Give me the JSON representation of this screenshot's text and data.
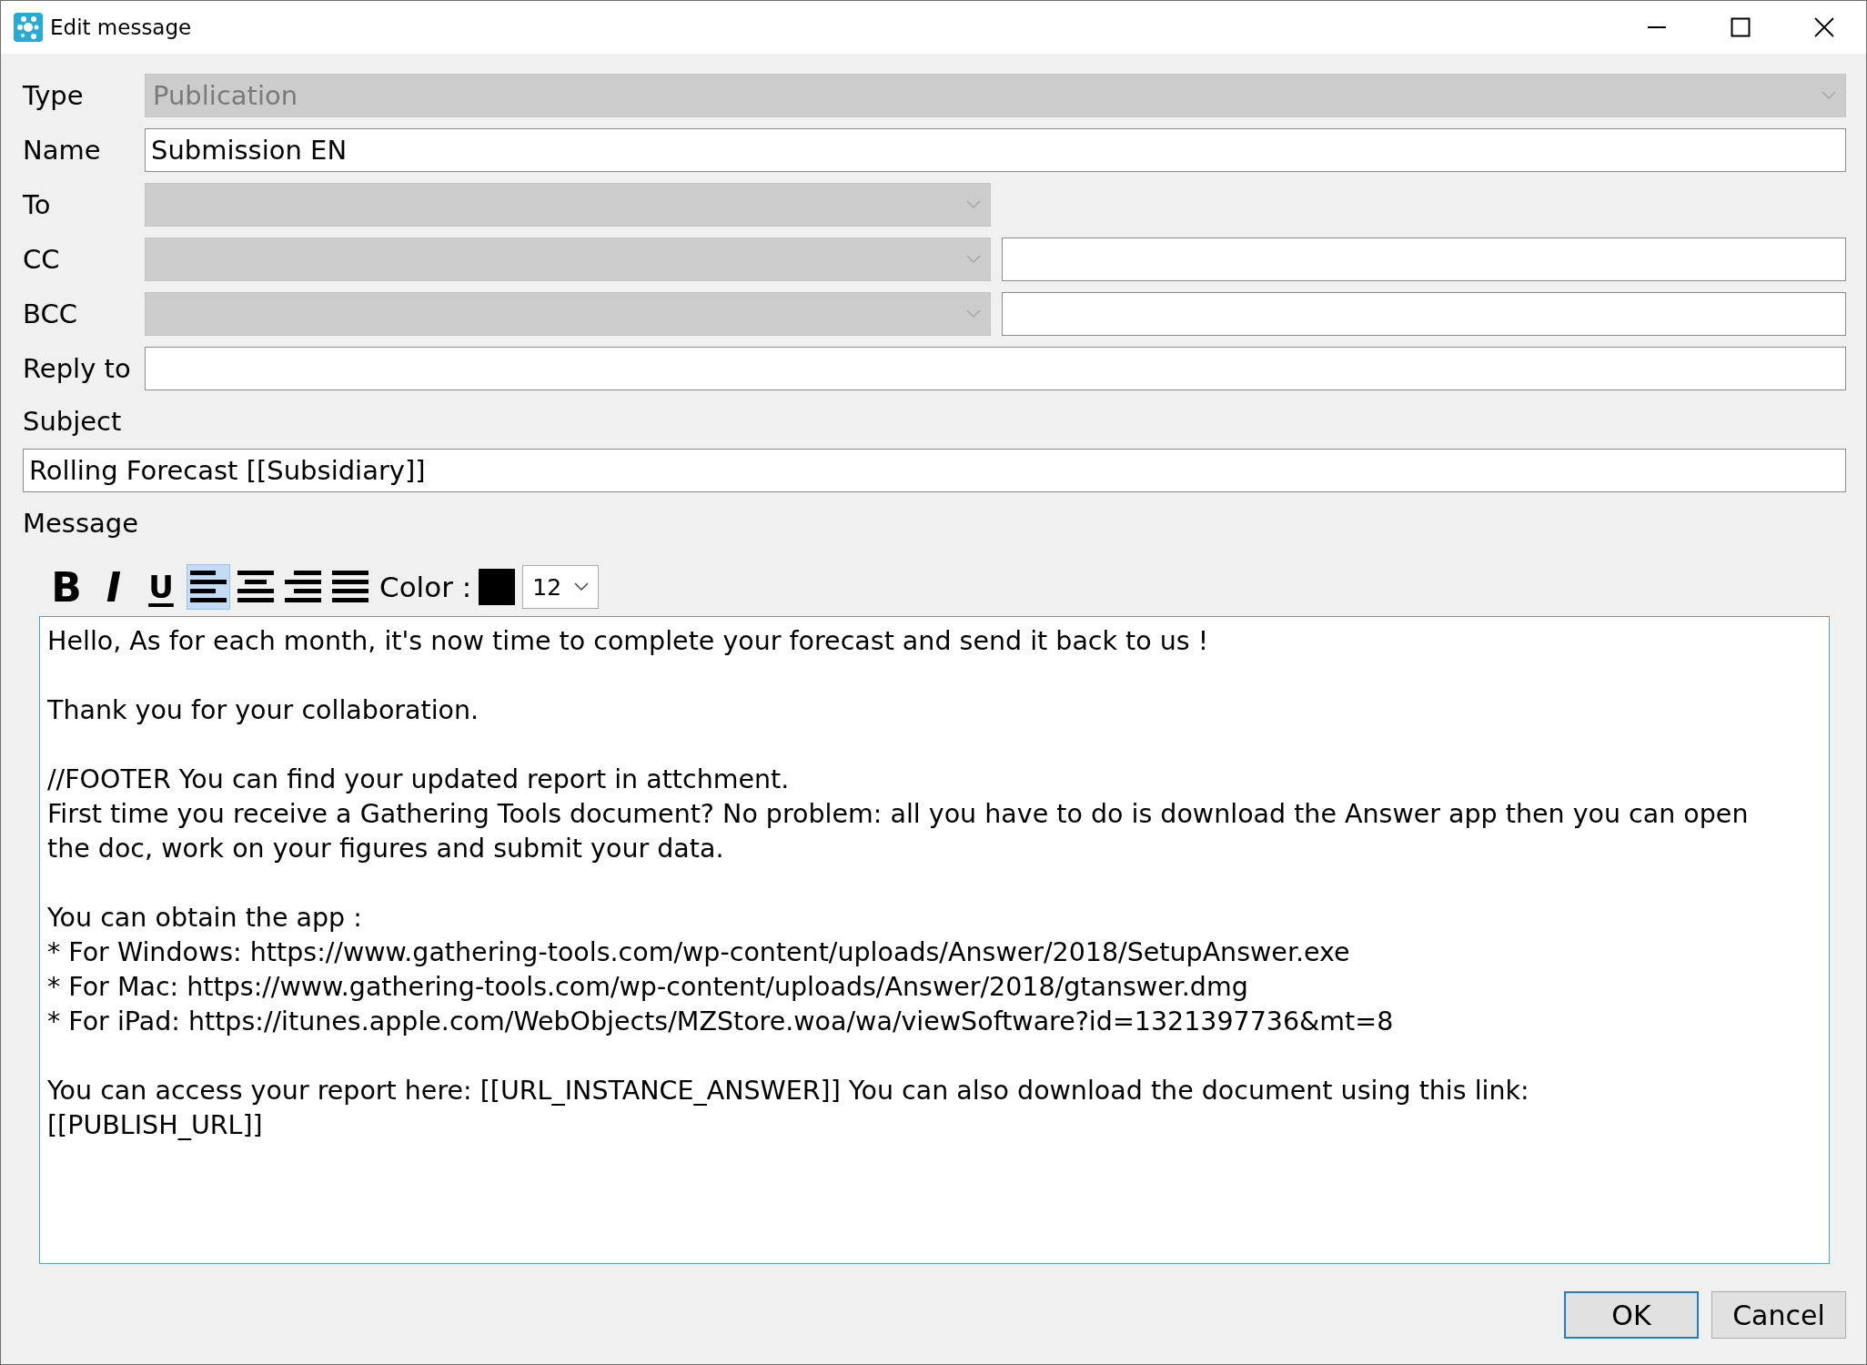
{
  "window": {
    "title": "Edit message"
  },
  "fields": [
    {
      "label": "Type",
      "kind": "combo",
      "value": "Publication",
      "disabled": true
    },
    {
      "label": "Name",
      "kind": "text",
      "value": "Submission EN",
      "disabled": false
    },
    {
      "label": "To",
      "kind": "combo",
      "disabled": true
    },
    {
      "label": "CC",
      "kind": "combo-with-field",
      "disabled": true
    },
    {
      "label": "BCC",
      "kind": "combo-with-field",
      "disabled": true
    },
    {
      "label": "Reply to",
      "kind": "text",
      "disabled": false
    }
  ],
  "subject": {
    "label": "Subject",
    "value": "Rolling Forecast [[Subsidiary]]"
  },
  "message": {
    "label": "Message",
    "toolbar": [
      {
        "kind": "bold",
        "label": "B",
        "selected": false
      },
      {
        "kind": "italic",
        "label": "I",
        "selected": false
      },
      {
        "kind": "underline",
        "label": "U",
        "selected": false
      },
      {
        "kind": "align-left",
        "selected": true
      },
      {
        "kind": "align-center",
        "selected": false
      },
      {
        "kind": "align-right",
        "selected": false
      },
      {
        "kind": "justify",
        "selected": false
      }
    ],
    "color_label": "Color :",
    "color": "#000000",
    "font_size": "12",
    "paragraphs": [
      [
        "Hello, As for each month, it's now time to complete your forecast and send it back to us !"
      ],
      [
        "Thank you for your collaboration."
      ],
      [
        "//FOOTER You can find your updated report in attchment.",
        "First time you receive a Gathering Tools document? No problem: all you have to do is download the Answer app then you can open",
        "the doc, work on your figures and submit your data."
      ],
      [
        "You can obtain the app :",
        "* For Windows: https://www.gathering-tools.com/wp-content/uploads/Answer/2018/SetupAnswer.exe",
        "* For Mac: https://www.gathering-tools.com/wp-content/uploads/Answer/2018/gtanswer.dmg",
        "* For iPad: https://itunes.apple.com/WebObjects/MZStore.woa/wa/viewSoftware?id=1321397736&mt=8"
      ],
      [
        "You can access your report here: [[URL_INSTANCE_ANSWER]] You can also download the document using this link:",
        "[[PUBLISH_URL]]"
      ]
    ]
  },
  "buttons": [
    {
      "label": "OK",
      "default": true
    },
    {
      "label": "Cancel",
      "default": false
    }
  ]
}
